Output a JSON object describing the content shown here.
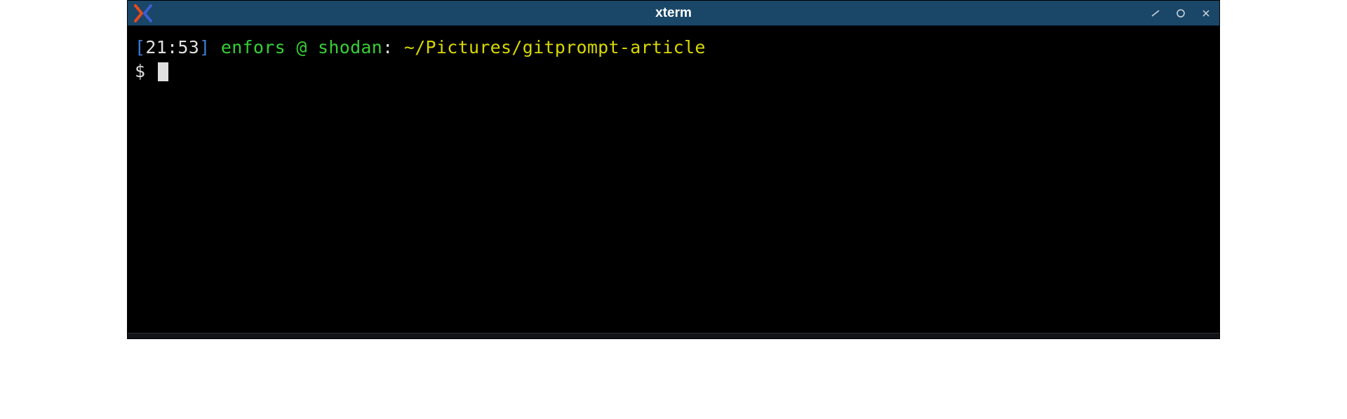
{
  "window": {
    "title": "xterm"
  },
  "prompt": {
    "bracket_open": "[",
    "time": "21:53",
    "bracket_close": "]",
    "user": "enfors",
    "at": "@",
    "host": "shodan",
    "colon": ":",
    "path": "~/Pictures/gitprompt-article",
    "ps1": "$"
  }
}
